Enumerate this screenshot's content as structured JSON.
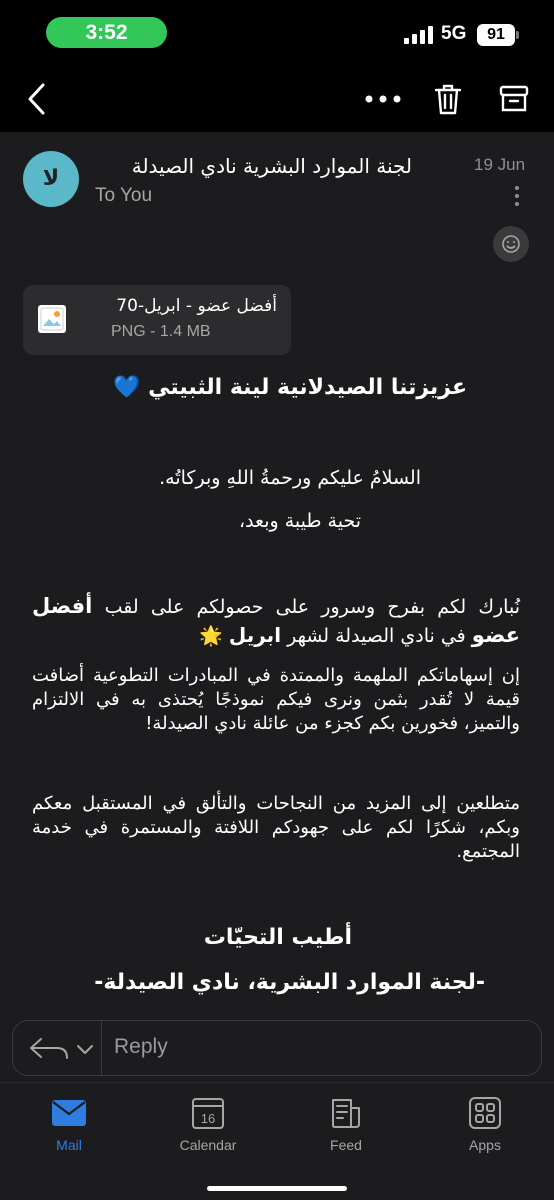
{
  "status_bar": {
    "time": "3:52",
    "network": "5G",
    "battery": "91"
  },
  "toolbar": {
    "back_icon": "chevron-left-icon",
    "more_icon": "more-horizontal-icon",
    "delete_icon": "trash-icon",
    "archive_icon": "archive-icon"
  },
  "message": {
    "avatar_initials": "لا",
    "sender": "لجنة الموارد البشرية نادي الصيدلة",
    "recipient": "To You",
    "date": "19 Jun",
    "attachment": {
      "name": "أفضل عضو - ابريل-70",
      "meta": "PNG - 1.4 MB"
    },
    "greeting": "عزيزتنا الصيدلانية لينة الثبيتي 💙",
    "salam": "السلامُ عليكم ورحمةُ اللهِ وبركاتُه.",
    "tahiya": "تحية طيبة وبعد،",
    "para1_part1": "نُبارك لكم بفرح وسرور على حصولكم على لقب ",
    "para1_bold1": "أفضل عضو",
    "para1_part2": " في نادي الصيدلة لشهر ",
    "para1_bold2": "ابريل",
    "para1_star": " 🌟",
    "para2": "إن إسهاماتكم الملهمة والممتدة في المبادرات التطوعية أضافت قيمة لا تُقدر بثمن ونرى فيكم نموذجًا يُحتذى به في الالتزام والتميز، فخورين بكم كجزء من عائلة نادي الصيدلة!",
    "para3": "متطلعين إلى المزيد من النجاحات والتألق في المستقبل معكم وبكم، شكرًا لكم على جهودكم اللافتة والمستمرة في خدمة المجتمع.",
    "closing": "أطيب التحيّات",
    "signature": "-لجنة الموارد البشرية، نادي الصيدلة-"
  },
  "reply": {
    "label": "Reply"
  },
  "tabs": [
    {
      "label": "Mail",
      "icon": "mail-icon",
      "active": true
    },
    {
      "label": "Calendar",
      "icon": "calendar-icon",
      "day": "16"
    },
    {
      "label": "Feed",
      "icon": "feed-icon"
    },
    {
      "label": "Apps",
      "icon": "apps-grid-icon"
    }
  ],
  "colors": {
    "accent": "#2f7de1",
    "avatar": "#5ab8c8",
    "status_pill": "#33c759",
    "background": "#1c1c1e"
  }
}
